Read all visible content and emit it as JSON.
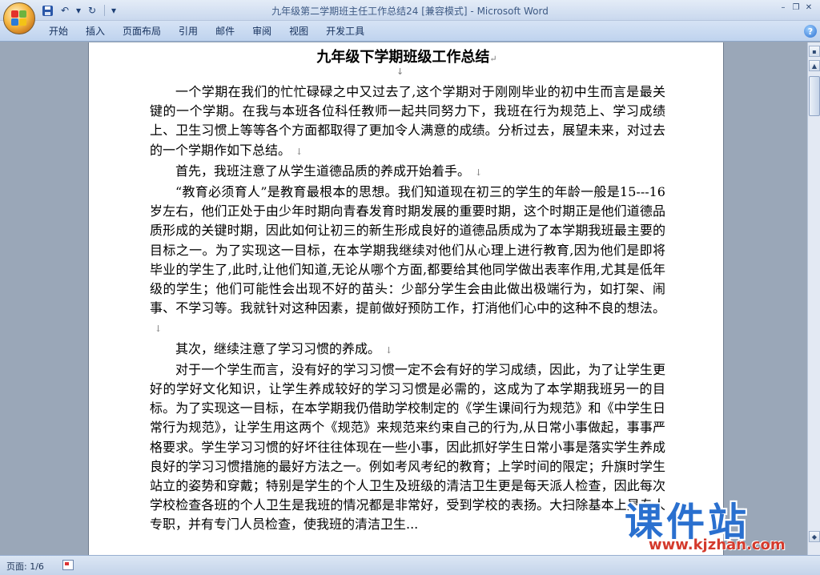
{
  "window": {
    "title": "九年级第二学期班主任工作总结24 [兼容模式] - Microsoft Word",
    "minimize": "–",
    "restore": "❐",
    "close": "✕"
  },
  "qat": {
    "save_icon": "save-icon",
    "undo": "↶",
    "undo_dropdown": "▾",
    "redo": "↻",
    "customize": "▾"
  },
  "ribbon": {
    "tabs": [
      "开始",
      "插入",
      "页面布局",
      "引用",
      "邮件",
      "审阅",
      "视图",
      "开发工具"
    ],
    "help": "?"
  },
  "document": {
    "title": "九年级下学期班级工作总结",
    "paragraph_mark": "↵",
    "line_break_mark": "↓",
    "paragraphs": [
      "一个学期在我们的忙忙碌碌之中又过去了,这个学期对于刚刚毕业的初中生而言是最关键的一个学期。在我与本班各位科任教师一起共同努力下，我班在行为规范上、学习成绩上、卫生习惯上等等各个方面都取得了更加令人满意的成绩。分析过去，展望未来，对过去的一个学期作如下总结。",
      "首先，我班注意了从学生道德品质的养成开始着手。",
      "“教育必须育人”是教育最根本的思想。我们知道现在初三的学生的年龄一般是15---16岁左右，他们正处于由少年时期向青春发育时期发展的重要时期，这个时期正是他们道德品质形成的关键时期，因此如何让初三的新生形成良好的道德品质成为了本学期我班最主要的目标之一。为了实现这一目标，在本学期我继续对他们从心理上进行教育,因为他们是即将毕业的学生了,此时,让他们知道,无论从哪个方面,都要给其他同学做出表率作用,尤其是低年级的学生；他们可能性会出现不好的苗头：少部分学生会由此做出极端行为，如打架、闹事、不学习等。我就针对这种因素，提前做好预防工作，打消他们心中的这种不良的想法。",
      "其次，继续注意了学习习惯的养成。",
      "对于一个学生而言，没有好的学习习惯一定不会有好的学习成绩，因此，为了让学生更好的学好文化知识，让学生养成较好的学习习惯是必需的，这成为了本学期我班另一的目标。为了实现这一目标，在本学期我仍借助学校制定的《学生课间行为规范》和《中学生日常行为规范》，让学生用这两个《规范》来规范来约束自己的行为,从日常小事做起，事事严格要求。学生学习习惯的好坏往往体现在一些小事，因此抓好学生日常小事是落实学生养成良好的学习习惯措施的最好方法之一。例如考风考纪的教育；上学时间的限定；升旗时学生站立的姿势和穿戴；特别是学生的个人卫生及班级的清洁卫生更是每天派人检查，因此每次学校检查各班的个人卫生是我班的情况都是非常好，受到学校的表扬。大扫除基本上是专人专职，并有专门人员检查，使我班的清洁卫生..."
    ]
  },
  "watermark": {
    "brand": "课件站",
    "url": "www.kjzhan.com"
  },
  "statusbar": {
    "page": "页面: 1/6"
  },
  "scrollbar": {
    "up": "▲",
    "page_prev": "◆"
  }
}
